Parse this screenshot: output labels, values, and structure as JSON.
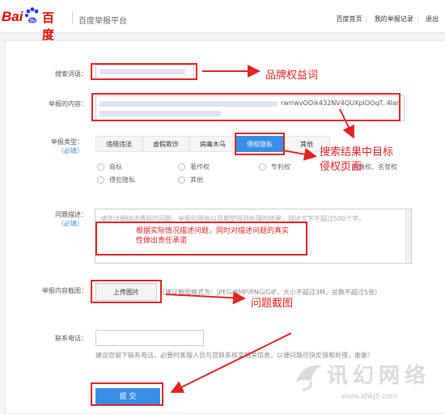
{
  "header": {
    "logo_latin_bai": "Bai",
    "logo_latin_du": "du",
    "logo_cn": "百度",
    "platform_title": "百度举报平台",
    "links": [
      "百度首页",
      "我的举报记录",
      "退出"
    ]
  },
  "form": {
    "search_term_label": "搜索词语：",
    "report_content_label": "举报的内容：",
    "report_url_suffix": "rwrrwvOOik432NV4QUXpIOOqT..4Iarb.....",
    "report_type_label": "举报类型：",
    "required_label": "（必填）",
    "tabs": [
      "违规违法",
      "虚假欺诈",
      "病毒木马",
      "侵权隐私",
      "其他"
    ],
    "radio_options_row1": [
      "商标",
      "著作权",
      "专利权",
      "肖像权、名誉权"
    ],
    "radio_options_row2": [
      "侵犯隐私",
      "其他"
    ],
    "problem_label": "问题描述：",
    "problem_placeholder": "请您详细描述遇到的问题，举报的理由以及期望得到处理的结果，描述文字不超过500个字。",
    "screenshot_label": "举报内容截图：",
    "upload_button": "上传图片",
    "upload_hint": "（建议截图格式为：JPEG/BMP/PNG/GIF，大小不超过3M，总数不超过5张）",
    "phone_label": "联系电话：",
    "phone_hint": "建议您留下联系电话，必要时客服人员与您联系核实相关信息，以便问题尽快反馈和处理，谢谢！",
    "submit_button": "提 交"
  },
  "annotations": {
    "brand_term": "品牌权益词",
    "search_target": "搜索结果中目标侵权页面",
    "describe": "根据实际情况描述问题，同时对描述问题的真实性做出责任承诺",
    "screenshot": "问题截图"
  },
  "watermark": {
    "title": "讯幻网络",
    "url": "www.xhkj5.com"
  },
  "colors": {
    "accent_blue": "#3a8ee6",
    "annotation_red": "#e02424",
    "baidu_red": "#e10602",
    "baidu_blue": "#2932e1"
  }
}
